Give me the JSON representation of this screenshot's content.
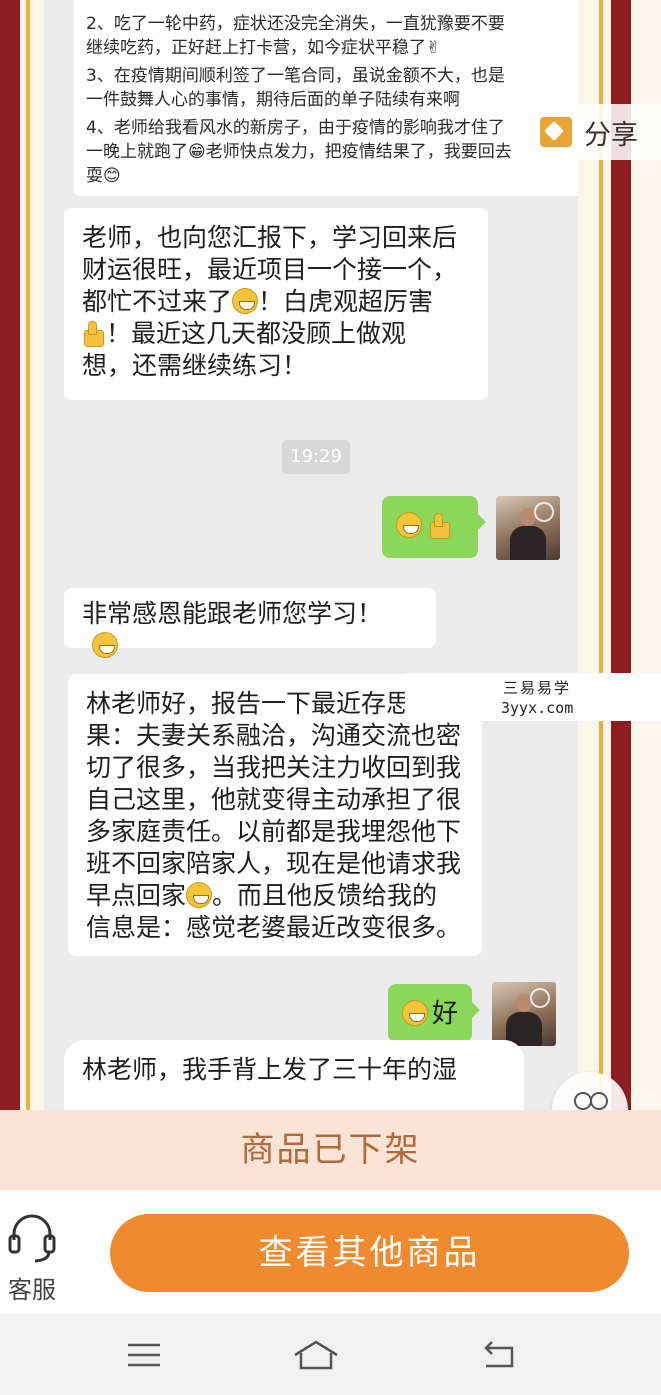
{
  "share": {
    "label": "分享"
  },
  "chat": {
    "top_lines": [
      "2、吃了一轮中药，症状还没完全消失，一直犹豫要不要",
      "继续吃药，正好赶上打卡营，如今症状平稳了✌",
      "3、在疫情期间顺利签了一笔合同，虽说金额不大，也是",
      "一件鼓舞人心的事情，期待后面的单子陆续有来啊",
      "4、老师给我看风水的新房子，由于疫情的影响我才住了",
      "一晚上就跑了😁老师快点发力，把疫情结果了，我要回去",
      "耍😊"
    ],
    "msg1": [
      "老师，也向您汇报下，学习回来后",
      "财运很旺，最近项目一个接一个，",
      "都忙不过来了",
      "！白虎观超厉害",
      "！最近这几天都没顾上做观",
      "想，还需继续练习！"
    ],
    "time": "19:29",
    "msg2": "非常感恩能跟老师您学习！",
    "msg3": [
      "林老师好，报告一下最近存思",
      "果：夫妻关系融洽，沟通交流也密",
      "切了很多，当我把关注力收回到我",
      "自己这里，他就变得主动承担了很",
      "多家庭责任。以前都是我埋怨他下",
      "班不回家陪家人，现在是他请求我",
      "早点回家",
      "。而且他反馈给我的",
      "信息是：感觉老婆最近改变很多。"
    ],
    "reply2": "好",
    "msg4": "林老师，我手背上发了三十年的湿"
  },
  "watermark": {
    "name": "三易易学",
    "domain": "3yyx.com"
  },
  "delisted_label": "商品已下架",
  "service_label": "客服",
  "cta_label": "查看其他商品",
  "colors": {
    "cta": "#f08a2f",
    "delisted_bg": "#fbe3d5",
    "bubble_green": "#8ad75a",
    "frame_red": "#8e1d22"
  },
  "icons": [
    "share-icon",
    "headset-icon",
    "menu-icon",
    "home-icon",
    "back-icon",
    "smile-icon",
    "thumbs-up-icon"
  ]
}
